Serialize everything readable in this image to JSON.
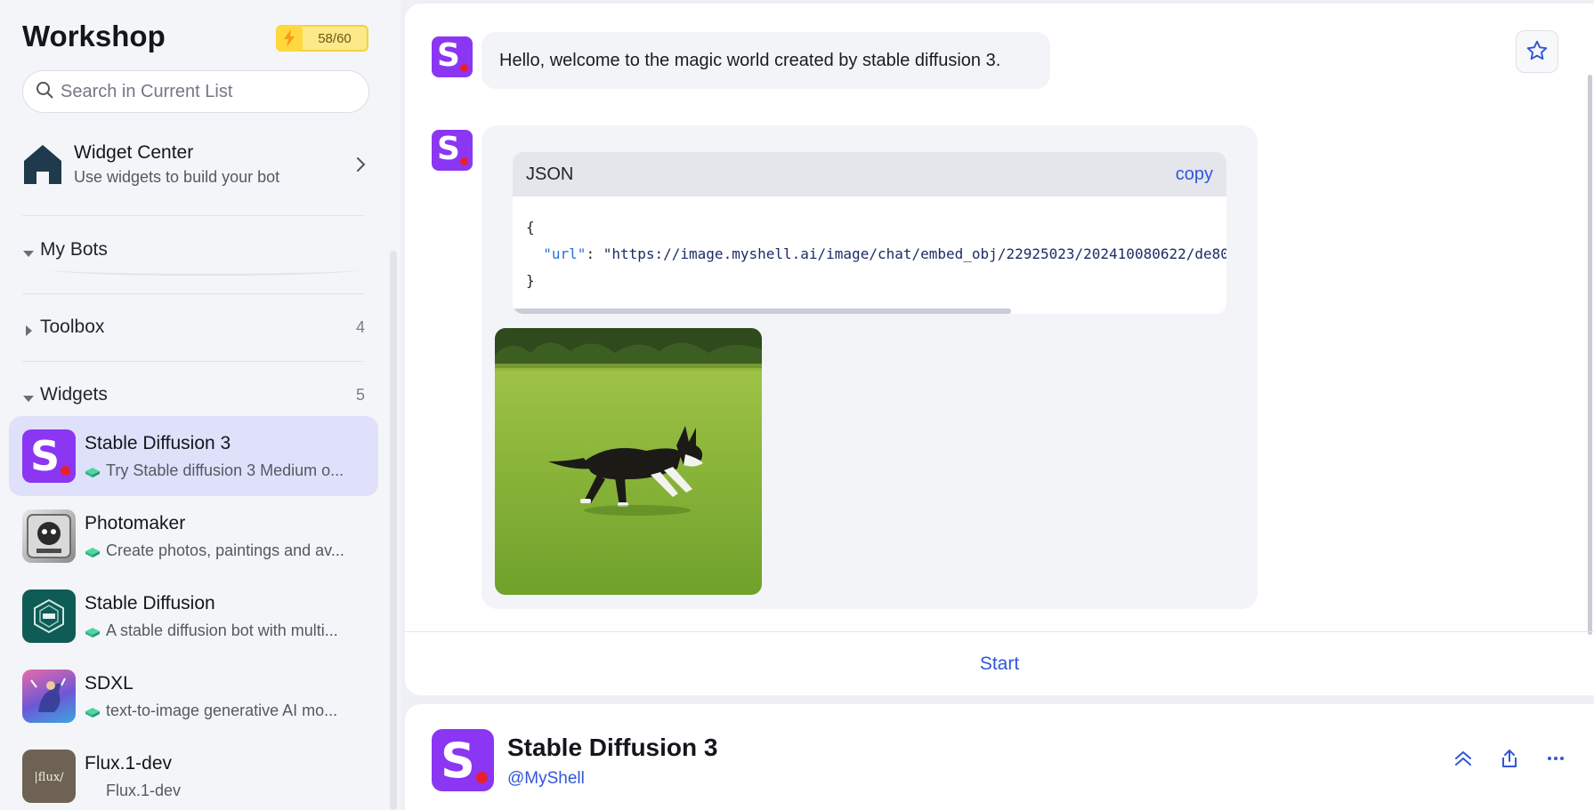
{
  "sidebar": {
    "title": "Workshop",
    "energy": "58/60",
    "search_placeholder": "Search in Current List",
    "widget_center": {
      "title": "Widget Center",
      "subtitle": "Use widgets to build your bot"
    },
    "sections": {
      "my_bots": {
        "label": "My Bots"
      },
      "toolbox": {
        "label": "Toolbox",
        "count": "4"
      },
      "widgets": {
        "label": "Widgets",
        "count": "5"
      }
    },
    "bots": [
      {
        "name": "Stable Diffusion 3",
        "desc": "Try Stable diffusion 3 Medium o..."
      },
      {
        "name": "Photomaker",
        "desc": "Create photos, paintings and av..."
      },
      {
        "name": "Stable Diffusion",
        "desc": "A stable diffusion bot with multi..."
      },
      {
        "name": "SDXL",
        "desc": "text-to-image generative AI mo..."
      },
      {
        "name": "Flux.1-dev",
        "desc": "Flux.1-dev"
      }
    ]
  },
  "chat": {
    "greeting": "Hello, welcome to the magic world created by stable diffusion 3.",
    "code": {
      "lang": "JSON",
      "copy_label": "copy",
      "open_brace": "{",
      "key": "\"url\"",
      "colon": ": ",
      "value": "\"https://image.myshell.ai/image/chat/embed_obj/22925023/202410080622/de80",
      "close_brace": "}"
    },
    "start_label": "Start"
  },
  "bot_info": {
    "name": "Stable Diffusion 3",
    "handle": "@MyShell"
  },
  "colors": {
    "accent": "#3156d9",
    "brand_purple": "#8b36f2",
    "brand_dot": "#e8202c",
    "active_item": "#dfe1fb"
  },
  "icons": {
    "energy": "lightning-bolt-icon",
    "search": "search-icon",
    "widget_center": "home-icon",
    "favorite": "star-icon",
    "collapse": "double-chevron-up-icon",
    "share": "share-icon",
    "more": "more-horizontal-icon"
  }
}
